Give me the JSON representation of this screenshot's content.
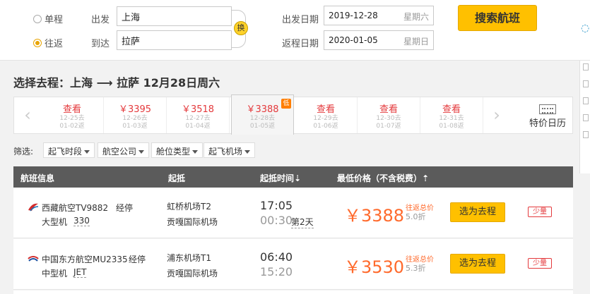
{
  "search": {
    "trip_oneway": "单程",
    "trip_round": "往返",
    "from_label": "出发",
    "to_label": "到达",
    "from_city": "上海",
    "to_city": "拉萨",
    "swap_label": "换",
    "depart_label": "出发日期",
    "return_label": "返程日期",
    "depart_date": "2019-12-28",
    "depart_weekday": "星期六",
    "return_date": "2020-01-05",
    "return_weekday": "星期日",
    "search_button": "搜索航班"
  },
  "route_title": "选择去程：上海 ⟶ 拉萨  12月28日周六",
  "date_strip": {
    "cells": [
      {
        "price": "查看",
        "d1": "12-25去",
        "d2": "01-02返"
      },
      {
        "price": "￥3395",
        "d1": "12-26去",
        "d2": "01-03返"
      },
      {
        "price": "￥3518",
        "d1": "12-27去",
        "d2": "01-04返"
      },
      {
        "price": "￥3388",
        "d1": "12-28去",
        "d2": "01-05返",
        "badge": "低"
      },
      {
        "price": "查看",
        "d1": "12-29去",
        "d2": "01-06返"
      },
      {
        "price": "查看",
        "d1": "12-30去",
        "d2": "01-07返"
      },
      {
        "price": "查看",
        "d1": "12-31去",
        "d2": "01-08返"
      }
    ],
    "prev": "‹",
    "next": "›",
    "calendar": "特价日历"
  },
  "filter": {
    "label": "筛选:",
    "options": [
      "起飞时段",
      "航空公司",
      "舱位类型",
      "起飞机场"
    ]
  },
  "table": {
    "col_flight": "航班信息",
    "col_depart": "起抵",
    "col_time": "起抵时间⇣",
    "col_price": "最低价格（不含税费）⇡"
  },
  "flights": [
    {
      "airline": "西藏航空TV9882",
      "stop": "经停",
      "plane_type": "大型机",
      "plane_model": "330",
      "dep_airport": "虹桥机场T2",
      "arr_airport": "贡嘎国际机场",
      "dep_time": "17:05",
      "arr_time": "00:30",
      "plus_day": "第2天",
      "price": "￥3388",
      "cashback": "往返总价",
      "discount": "5.0折",
      "button": "选为去程",
      "badge": "少量"
    },
    {
      "airline": "中国东方航空MU2335",
      "stop": "经停",
      "plane_type": "中型机",
      "plane_model": "JET",
      "dep_airport": "浦东机场T1",
      "arr_airport": "贡嘎国际机场",
      "dep_time": "06:40",
      "arr_time": "15:20",
      "plus_day": "",
      "price": "￥3530",
      "cashback": "往返总价",
      "discount": "5.3折",
      "button": "选为去程",
      "badge": "少量"
    }
  ],
  "colors": {
    "accent": "#ffc000",
    "price": "#ff6a2c",
    "header": "#5b5b5b"
  }
}
